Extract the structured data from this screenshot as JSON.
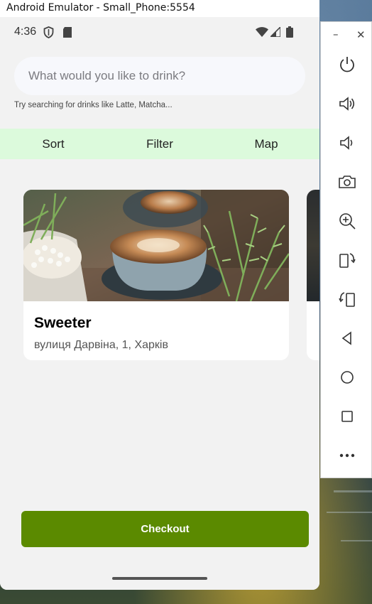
{
  "window": {
    "title": "Android Emulator - Small_Phone:5554"
  },
  "statusbar": {
    "time": "4:36"
  },
  "search": {
    "placeholder": "What would you like to drink?",
    "hint": "Try searching for drinks like Latte, Matcha..."
  },
  "toolbar": {
    "sort_label": "Sort",
    "filter_label": "Filter",
    "map_label": "Map"
  },
  "cards": [
    {
      "title": "Sweeter",
      "address": "вулиця Дарвіна, 1, Харків"
    }
  ],
  "checkout": {
    "label": "Checkout"
  },
  "colors": {
    "toolbar_bg": "#dcfadc",
    "checkout_bg": "#5b8a00",
    "screen_bg": "#f2f2f2"
  },
  "side_panel": {
    "icons": [
      "power-icon",
      "volume-up-icon",
      "volume-down-icon",
      "camera-icon",
      "zoom-in-icon",
      "rotate-left-icon",
      "rotate-right-icon",
      "back-icon",
      "home-icon",
      "overview-icon",
      "more-icon"
    ]
  }
}
